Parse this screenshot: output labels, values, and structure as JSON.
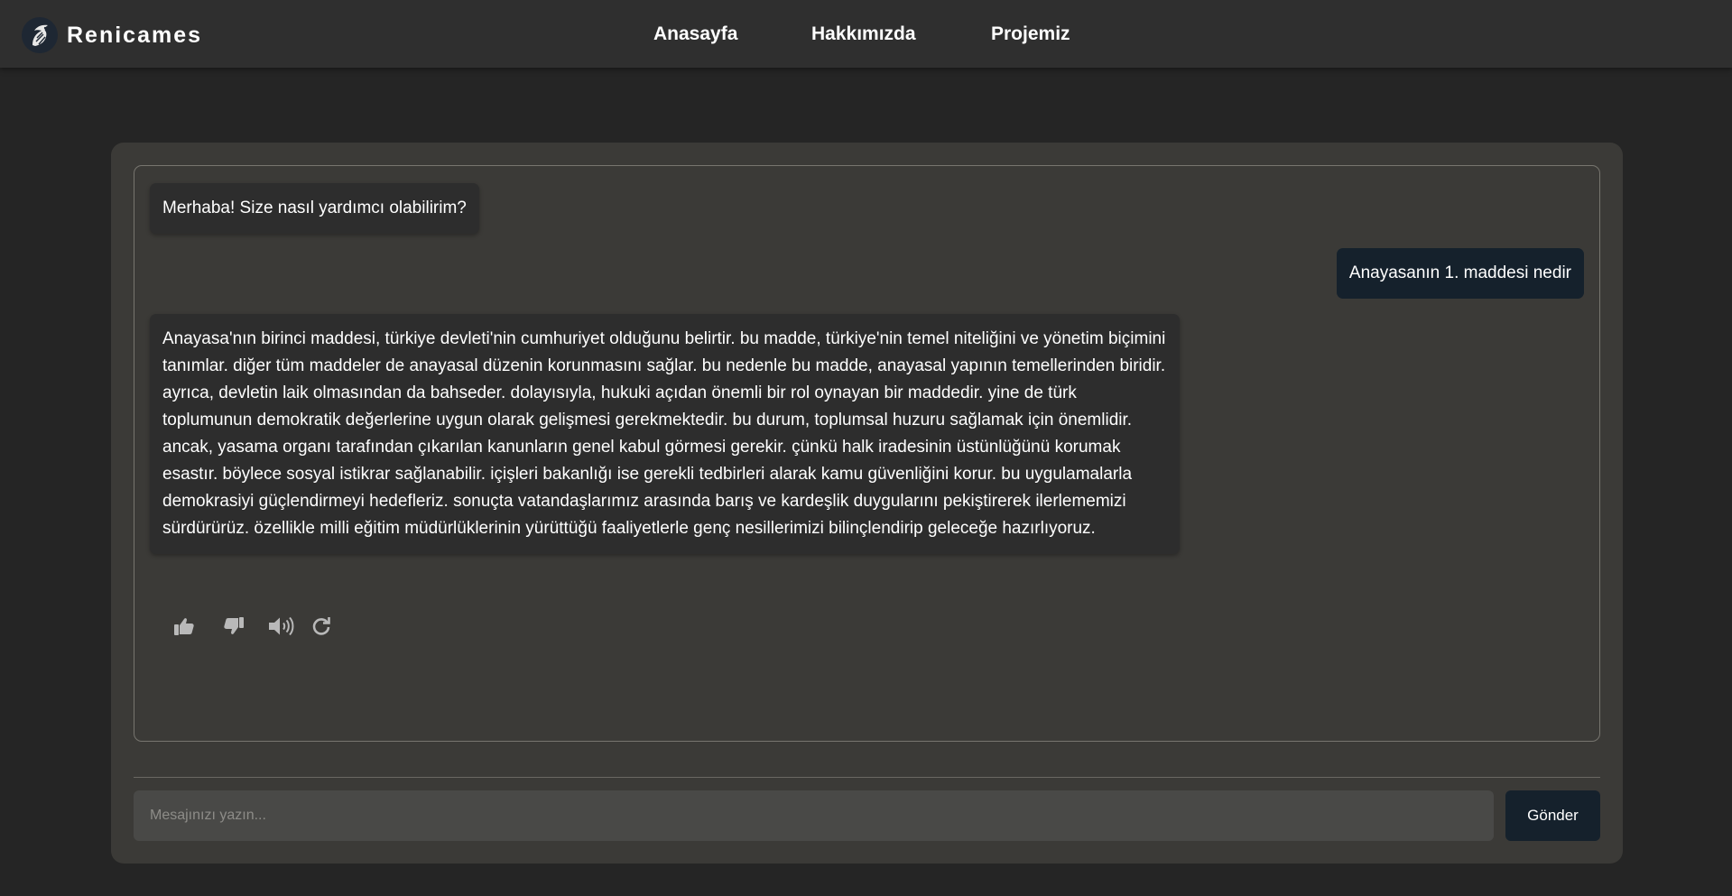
{
  "navbar": {
    "brand_name": "Renicames",
    "logo_icon": "dragon-logo-icon",
    "links": [
      {
        "label": "Anasayfa"
      },
      {
        "label": "Hakkımızda"
      },
      {
        "label": "Projemiz"
      }
    ]
  },
  "chat": {
    "messages": [
      {
        "role": "bot",
        "text": "Merhaba! Size nasıl yardımcı olabilirim?"
      },
      {
        "role": "user",
        "text": "Anayasanın 1. maddesi nedir"
      },
      {
        "role": "bot",
        "text": "Anayasa'nın birinci maddesi, türkiye devleti'nin cumhuriyet olduğunu belirtir. bu madde, türkiye'nin temel niteliğini ve yönetim biçimini tanımlar. diğer tüm maddeler de anayasal düzenin korunmasını sağlar. bu nedenle bu madde, anayasal yapının temellerinden biridir. ayrıca, devletin laik olmasından da bahseder. dolayısıyla, hukuki açıdan önemli bir rol oynayan bir maddedir. yine de türk toplumunun demokratik değerlerine uygun olarak gelişmesi gerekmektedir. bu durum, toplumsal huzuru sağlamak için önemlidir. ancak, yasama organı tarafından çıkarılan kanunların genel kabul görmesi gerekir. çünkü halk iradesinin üstünlüğünü korumak esastır. böylece sosyal istikrar sağlanabilir. içişleri bakanlığı ise gerekli tedbirleri alarak kamu güvenliğini korur. bu uygulamalarla demokrasiyi güçlendirmeyi hedefleriz. sonuçta vatandaşlarımız arasında barış ve kardeşlik duygularını pekiştirerek ilerlememizi sürdürürüz. özellikle milli eğitim müdürlüklerinin yürüttüğü faaliyetlerle genç nesillerimizi bilinçlendirip geleceğe hazırlıyoruz."
      }
    ],
    "actions": [
      {
        "icon": "thumbs-up-icon"
      },
      {
        "icon": "thumbs-down-icon"
      },
      {
        "icon": "speaker-icon"
      },
      {
        "icon": "regenerate-icon"
      }
    ]
  },
  "composer": {
    "input_value": "",
    "placeholder": "Mesajınızı yazın...",
    "send_label": "Gönder"
  },
  "colors": {
    "page_background": "#252525",
    "navbar_background": "#2f2f2f",
    "card_background": "#3b3a37",
    "bot_bubble": "#2d2d2d",
    "user_bubble": "#15212c",
    "input_background": "#494947",
    "send_button": "#15212c",
    "icon_color": "#b9b9b9"
  }
}
